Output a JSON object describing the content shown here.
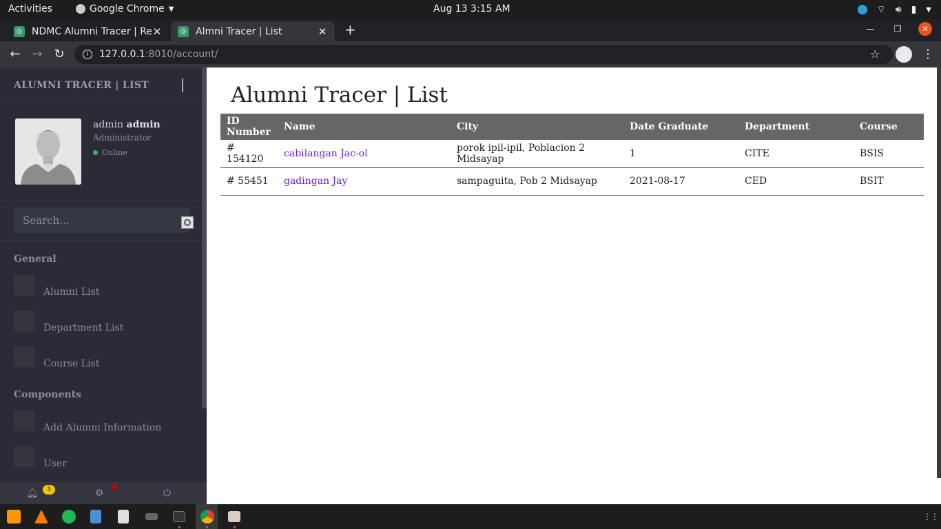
{
  "system_bar": {
    "activities": "Activities",
    "app_name": "Google Chrome",
    "clock": "Aug 13   3:15 AM"
  },
  "browser": {
    "tabs": [
      {
        "title": "NDMC Alumni Tracer | Reg",
        "active": false
      },
      {
        "title": "Almni Tracer | List",
        "active": true
      }
    ],
    "url_host": "127.0.0.1",
    "url_path": ":8010/account/"
  },
  "sidebar": {
    "brand": "ALUMNI TRACER | LIST",
    "user": {
      "first": "admin",
      "last": "admin",
      "role": "Administrator",
      "status": "Online"
    },
    "search_placeholder": "Search...",
    "sections": [
      {
        "title": "General",
        "items": [
          "Alumni List",
          "Department List",
          "Course List"
        ]
      },
      {
        "title": "Components",
        "items": [
          "Add Alumni Information",
          "User"
        ]
      }
    ],
    "notifications_count": "3"
  },
  "main": {
    "page_title": "Alumni Tracer | List",
    "table": {
      "headers": [
        "ID Number",
        "Name",
        "City",
        "Date Graduate",
        "Department",
        "Course"
      ],
      "rows": [
        {
          "id": "# 154120",
          "name": "cabilangan Jac-ol",
          "city": "porok ipil-ipil, Poblacion 2 Midsayap",
          "date": "1",
          "department": "CITE",
          "course": "BSIS"
        },
        {
          "id": "# 55451",
          "name": "gadingan Jay",
          "city": "sampaguita, Pob 2 Midsayap",
          "date": "2021-08-17",
          "department": "CED",
          "course": "BSIT"
        }
      ]
    }
  },
  "colors": {
    "sidebar_bg": "#2a2b36",
    "table_header_bg": "#666666",
    "link": "#6a1fd0",
    "ubuntu_orange": "#e95420"
  }
}
